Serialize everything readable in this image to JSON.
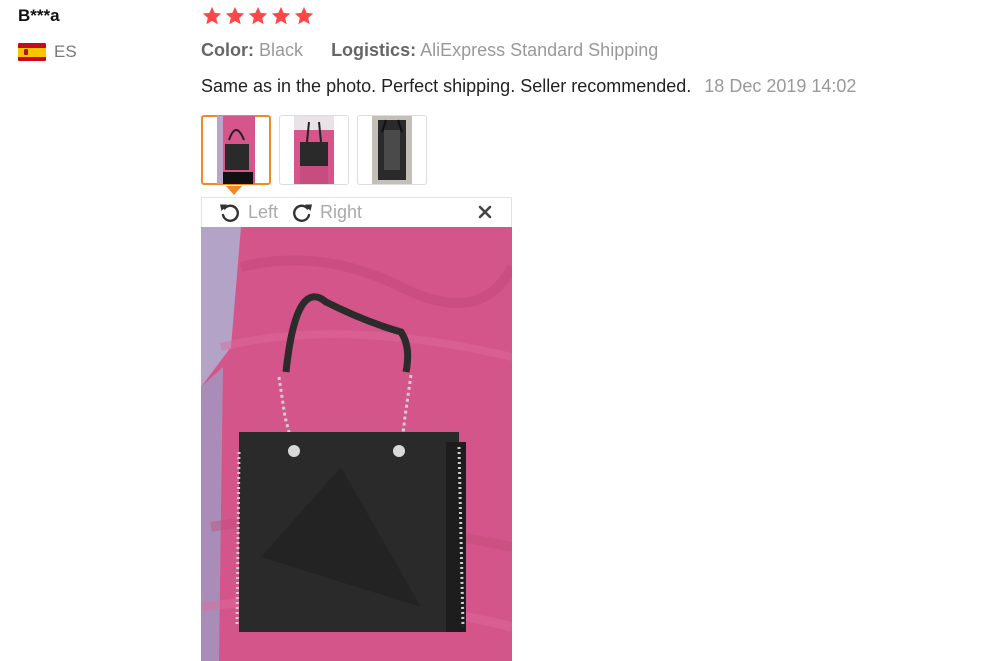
{
  "review": {
    "buyer_name": "B***a",
    "country_code": "ES",
    "rating": 5,
    "color_label": "Color:",
    "color_value": "Black",
    "logistics_label": "Logistics:",
    "logistics_value": "AliExpress Standard Shipping",
    "text": "Same as in the photo. Perfect shipping. Seller recommended.",
    "date": "18 Dec 2019 14:02",
    "photo_count": 3,
    "selected_photo_index": 0
  },
  "viewer": {
    "rotate_left_label": "Left",
    "rotate_right_label": "Right"
  },
  "colors": {
    "star": "#ff4747",
    "accent_border": "#f08a24",
    "pink_fabric": "#d6558a",
    "bag": "#2a2a2a"
  },
  "icons": {
    "rotate_left": "rotate-left-icon",
    "rotate_right": "rotate-right-icon",
    "close": "close-icon",
    "flag": "spain-flag-icon"
  }
}
